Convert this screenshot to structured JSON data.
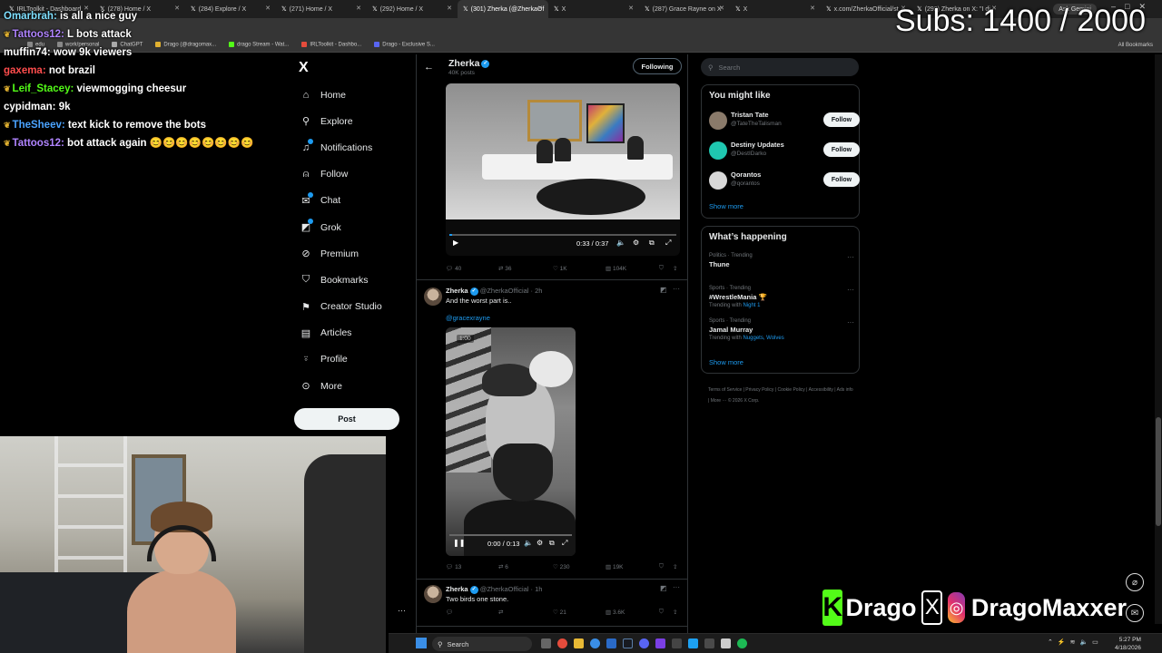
{
  "browser": {
    "tabs": [
      {
        "label": "IRLToolkit - Dashboard",
        "active": false
      },
      {
        "label": "(278) Home / X",
        "active": false
      },
      {
        "label": "(284) Explore / X",
        "active": false
      },
      {
        "label": "(271) Home / X",
        "active": false
      },
      {
        "label": "(292) Home / X",
        "active": false
      },
      {
        "label": "(301) Zherka (@ZherkaOf",
        "active": true
      },
      {
        "label": "X",
        "active": false
      },
      {
        "label": "(287) Grace Rayne on X",
        "active": false
      },
      {
        "label": "X",
        "active": false
      },
      {
        "label": "x.com/ZherkaOfficial/st",
        "active": false
      },
      {
        "label": "(292) Zherka on X: \"I di",
        "active": false
      }
    ],
    "ask_gemini": "Ask Gemini",
    "bookmarks": [
      "edu",
      "work/personal",
      "ChatGPT",
      "Drago (@dragomax...",
      "drago Stream - Wat...",
      "IRLToolkit - Dashbo...",
      "Drago - Exclusive S..."
    ],
    "all_bookmarks": "All Bookmarks"
  },
  "chat": [
    {
      "user": "Omarbrah:",
      "color": "#7fe0ff",
      "text": " is all a nice guy",
      "badge": ""
    },
    {
      "user": "Tattoos12:",
      "color": "#b084ff",
      "text": " L bots attack",
      "badge": "❦"
    },
    {
      "user": "muffin74:",
      "color": "#ffffff",
      "text": " wow 9k viewers",
      "badge": ""
    },
    {
      "user": "gaxema:",
      "color": "#ff4d4d",
      "text": " not brazil",
      "badge": ""
    },
    {
      "user": "Leif_Stacey:",
      "color": "#53fc18",
      "text": " viewmogging cheesur",
      "badge": "❦"
    },
    {
      "user": "cypidman:",
      "color": "#ffffff",
      "text": " 9k",
      "badge": ""
    },
    {
      "user": "TheSheev:",
      "color": "#4aa3ff",
      "text": " text kick to remove the bots",
      "badge": "❦"
    },
    {
      "user": "Tattoos12:",
      "color": "#b084ff",
      "text": " bot attack again 😊😊😊😊😊😊😊😊",
      "badge": "❦"
    }
  ],
  "subs": "Subs: 1400 / 2000",
  "nav": {
    "logo": "X",
    "items": [
      {
        "label": "Home",
        "icon": "⌂",
        "dot": false
      },
      {
        "label": "Explore",
        "icon": "⚲",
        "dot": false
      },
      {
        "label": "Notifications",
        "icon": "♫",
        "dot": true
      },
      {
        "label": "Follow",
        "icon": "⍝",
        "dot": false
      },
      {
        "label": "Chat",
        "icon": "✉",
        "dot": true
      },
      {
        "label": "Grok",
        "icon": "◩",
        "dot": true
      },
      {
        "label": "Premium",
        "icon": "⊘",
        "dot": false
      },
      {
        "label": "Bookmarks",
        "icon": "⛉",
        "dot": false
      },
      {
        "label": "Creator Studio",
        "icon": "⚑",
        "dot": false
      },
      {
        "label": "Articles",
        "icon": "▤",
        "dot": false
      },
      {
        "label": "Profile",
        "icon": "⍤",
        "dot": false
      },
      {
        "label": "More",
        "icon": "⊙",
        "dot": false
      }
    ],
    "post": "Post",
    "more_dots": "···"
  },
  "profile": {
    "name": "Zherka",
    "posts": "40K posts",
    "following": "Following",
    "back": "←"
  },
  "tweets": {
    "t1": {
      "video_time": "0:33 / 0:37",
      "progress": 0.01,
      "replies": "40",
      "reposts": "36",
      "likes": "1K",
      "views": "104K"
    },
    "t2": {
      "name": "Zherka",
      "handle": "@ZherkaOfficial · 2h",
      "text": "And the worst part is..",
      "link": "@gracexrayne",
      "badge": "1:00",
      "video_time": "0:00 / 0:13",
      "replies": "13",
      "reposts": "6",
      "likes": "230",
      "views": "19K"
    },
    "t3": {
      "name": "Zherka",
      "handle": "@ZherkaOfficial · 1h",
      "text": "Two birds one stone.",
      "replies": "",
      "reposts": "",
      "likes": "21",
      "views": "3.6K"
    }
  },
  "sidebar": {
    "search_placeholder": "Search",
    "might_like": {
      "title": "You might like",
      "users": [
        {
          "name": "Tristan Tate",
          "handle": "@TateTheTalisman",
          "follow": "Follow",
          "avatar_color": "#8a7a6a"
        },
        {
          "name": "Destiny Updates",
          "handle": "@DestIDarko",
          "follow": "Follow",
          "avatar_color": "#1fc7b0"
        },
        {
          "name": "Qorantos",
          "handle": "@qorantos",
          "follow": "Follow",
          "avatar_color": "#d8d8d8"
        }
      ],
      "show_more": "Show more"
    },
    "happening": {
      "title": "What’s happening",
      "trends": [
        {
          "category": "Politics · Trending",
          "name": "Thune",
          "with": ""
        },
        {
          "category": "Sports · Trending",
          "name": "#WrestleMania 🏆",
          "with": "Night 1"
        },
        {
          "category": "Sports · Trending",
          "name": "Jamal Murray",
          "with": "Nuggets, Wolves"
        }
      ],
      "trending_with": "Trending with ",
      "show_more": "Show more"
    },
    "footer": "Terms of Service | Privacy Policy | Cookie Policy | Accessibility | Ads info | More ··· © 2026 X Corp."
  },
  "brand": {
    "k": "K",
    "name1": "Drago",
    "x": "X",
    "ig": "◎",
    "name2": "DragoMaxxer"
  },
  "taskbar": {
    "search": "Search",
    "time": "5:27 PM",
    "date": "4/18/2026"
  }
}
